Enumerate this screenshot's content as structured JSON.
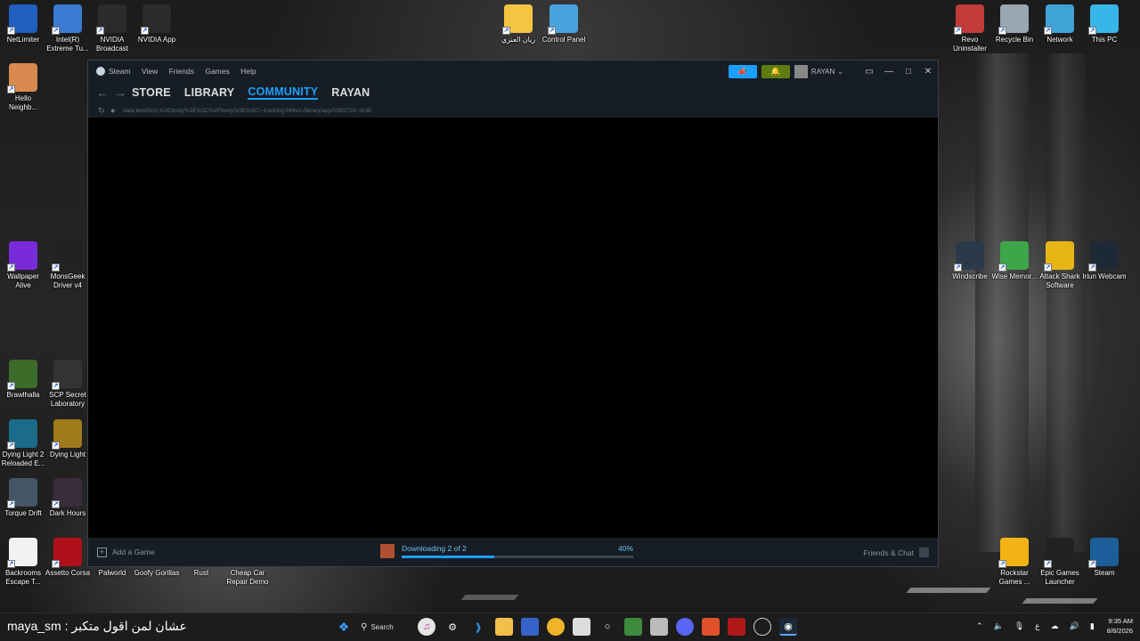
{
  "desktop": {
    "icons_left": [
      {
        "label": "NetLimiter",
        "icon": "netlimiter-icon",
        "color": "#1f5fbf"
      },
      {
        "label": "Intel(R) Extreme Tu...",
        "icon": "intel-xtu-icon",
        "color": "#3a7bd5"
      },
      {
        "label": "NVIDIA Broadcast",
        "icon": "nvidia-broadcast-icon",
        "color": "#2b2b2b"
      },
      {
        "label": "NVIDIA App",
        "icon": "nvidia-app-icon",
        "color": "#2b2b2b"
      },
      {
        "label": "Hello Neighb...",
        "icon": "hello-neighbor-icon",
        "color": "#d98a4e"
      },
      {
        "label": "Wallpaper Alive",
        "icon": "wallpaper-alive-icon",
        "color": "#7a2bd9"
      },
      {
        "label": "MonsGeek Driver v4",
        "icon": "monsgeek-icon",
        "color": "#222222"
      },
      {
        "label": "Brawlhalla",
        "icon": "brawlhalla-icon",
        "color": "#3d6b2a"
      },
      {
        "label": "SCP Secret Laboratory",
        "icon": "scp-icon",
        "color": "#333333"
      },
      {
        "label": "Dying Light 2 Reloaded E...",
        "icon": "dying-light-2-icon",
        "color": "#1b6c8a"
      },
      {
        "label": "Dying Light",
        "icon": "dying-light-icon",
        "color": "#a07a1b"
      },
      {
        "label": "Torque Drift",
        "icon": "torque-drift-icon",
        "color": "#445566"
      },
      {
        "label": "Dark Hours",
        "icon": "dark-hours-icon",
        "color": "#3a2c3a"
      },
      {
        "label": "Backrooms Escape T...",
        "icon": "backrooms-icon",
        "color": "#f2f2f2"
      },
      {
        "label": "Assetto Corsa",
        "icon": "assetto-corsa-icon",
        "color": "#b0101a"
      },
      {
        "label": "Palworld",
        "icon": "palworld-icon",
        "color": ""
      },
      {
        "label": "Goofy Gorillas",
        "icon": "goofy-gorillas-icon",
        "color": ""
      },
      {
        "label": "Rust",
        "icon": "rust-icon",
        "color": ""
      },
      {
        "label": "Cheap Car Repair Demo",
        "icon": "cheap-car-repair-icon",
        "color": ""
      }
    ],
    "icons_top": [
      {
        "label": "ريان العنزي",
        "icon": "folder-icon",
        "color": "#f5c542"
      },
      {
        "label": "Control Panel",
        "icon": "control-panel-icon",
        "color": "#4aa3df"
      }
    ],
    "icons_right": [
      {
        "label": "Revo Uninstaller",
        "icon": "revo-icon",
        "color": "#c23b3b"
      },
      {
        "label": "Recycle Bin",
        "icon": "recycle-bin-icon",
        "color": "#9aa6b2"
      },
      {
        "label": "Network",
        "icon": "network-icon",
        "color": "#3fa3d8"
      },
      {
        "label": "This PC",
        "icon": "this-pc-icon",
        "color": "#38b6e8"
      },
      {
        "label": "Windscribe",
        "icon": "windscribe-icon",
        "color": "#2a3a4a"
      },
      {
        "label": "Wise Memor...",
        "icon": "wise-memory-icon",
        "color": "#3da64a"
      },
      {
        "label": "Attack Shark Software",
        "icon": "attack-shark-icon",
        "color": "#e8b517"
      },
      {
        "label": "Iriun Webcam",
        "icon": "iriun-icon",
        "color": "#1d2a36"
      },
      {
        "label": "Rockstar Games ...",
        "icon": "rockstar-icon",
        "color": "#f3b314"
      },
      {
        "label": "Epic Games Launcher",
        "icon": "epic-games-icon",
        "color": "#222222"
      },
      {
        "label": "Steam",
        "icon": "steam-icon",
        "color": "#1b5e9a"
      }
    ]
  },
  "steam": {
    "title_menu": [
      "Steam",
      "View",
      "Friends",
      "Games",
      "Help"
    ],
    "username": "RAYAN",
    "nav": {
      "store": "STORE",
      "library": "LIBRARY",
      "community": "COMMUNITY",
      "profile": "RAYAN"
    },
    "url": "data:text/html,%3Cbody%3E%3C%2Fbody%3E%3C!--tracking:it49vn:/library/app/1092710--%3E",
    "bottom": {
      "add_game": "Add a Game",
      "download_status": "Downloading 2 of 2",
      "download_percent": "40%",
      "download_progress": 0.4,
      "friends_chat": "Friends & Chat"
    }
  },
  "taskbar": {
    "left_text": "maya_sm : عشان لمن اقول متكبر",
    "search_label": "Search",
    "time": "9:35 AM",
    "date": "8/8/2026",
    "lang": "ع"
  }
}
